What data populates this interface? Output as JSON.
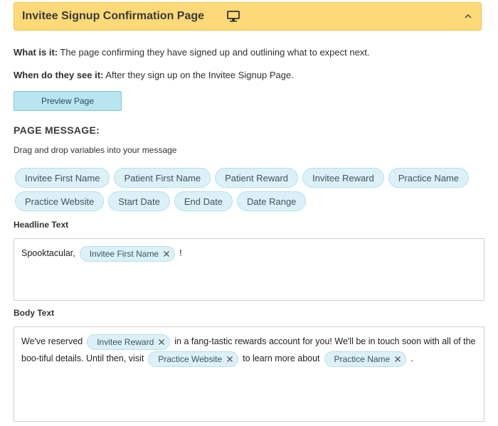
{
  "header": {
    "title": "Invitee Signup Confirmation Page",
    "monitor_icon": "monitor-icon",
    "collapse_icon": "chevron-up-icon",
    "bg_color": "#fdd978"
  },
  "info": {
    "what_label": "What is it:",
    "what_text": " The page confirming they have signed up and outlining what to expect next.",
    "when_label": "When do they see it:",
    "when_text": " After they sign up on the Invitee Signup Page."
  },
  "preview_button": "Preview Page",
  "page_message": {
    "title": "PAGE MESSAGE:",
    "hint": "Drag and drop variables into your message"
  },
  "variables": [
    "Invitee First Name",
    "Patient First Name",
    "Patient Reward",
    "Invitee Reward",
    "Practice Name",
    "Practice Website",
    "Start Date",
    "End Date",
    "Date Range"
  ],
  "headline": {
    "label": "Headline Text",
    "prefix": "Spooktacular,",
    "token": "Invitee First Name",
    "suffix": "!"
  },
  "body": {
    "label": "Body Text",
    "text1": "We've reserved",
    "token1": "Invitee Reward",
    "text2": "in a fang-tastic rewards account for you! We'll be in touch soon with all of the boo-tiful details. Until then, visit",
    "token2": "Practice Website",
    "text3": "to learn more about",
    "token3": "Practice Name",
    "text4": "."
  }
}
